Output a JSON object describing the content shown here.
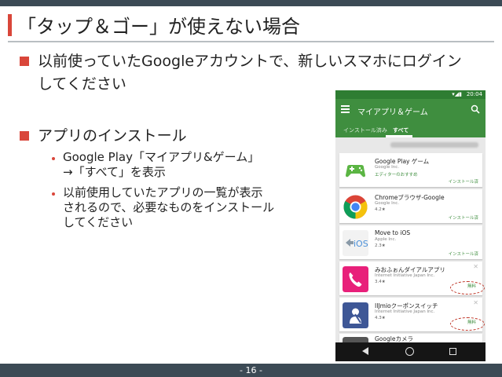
{
  "slide": {
    "title": "「タップ＆ゴー」が使えない場合",
    "page_number": "- 16 -"
  },
  "bullets": [
    {
      "text": "以前使っていたGoogleアカウントで、新しいスマホにログインしてください"
    },
    {
      "text": "アプリのインストール",
      "sub": [
        {
          "line1": "Google Play「マイアプリ&ゲーム」",
          "line2": "→「すべて」を表示"
        },
        {
          "line1": "以前使用していたアプリの一覧が表示",
          "line2": "されるので、必要なものをインストール",
          "line3": "してください"
        }
      ]
    }
  ],
  "phone": {
    "status_time": "20:04",
    "app_bar_title": "マイアプリ＆ゲーム",
    "tabs": [
      "インストール済み",
      "すべて"
    ],
    "apps": [
      {
        "name": "Google Play ゲーム",
        "developer": "Google Inc.",
        "extra": "エディターのおすすめ",
        "status": "インストール済",
        "icon": "google-play-games-icon"
      },
      {
        "name": "Chromeブラウザ-Google",
        "developer": "Google Inc.",
        "extra": "4.2★",
        "status": "インストール済",
        "icon": "chrome-icon"
      },
      {
        "name": "Move to iOS",
        "developer": "Apple Inc.",
        "extra": "2.3★",
        "status": "インストール済",
        "icon": "move-to-ios-icon"
      },
      {
        "name": "みおふぉんダイアルアプリ",
        "developer": "Internet Initiative Japan Inc.",
        "extra": "3.4★",
        "status": "無料",
        "icon": "phone-dial-icon"
      },
      {
        "name": "IIJmioクーポンスイッチ",
        "developer": "Internet Initiative Japan Inc.",
        "extra": "4.3★",
        "status": "無料",
        "icon": "coupon-switch-icon"
      },
      {
        "name": "Googleカメラ",
        "icon": "google-camera-icon"
      }
    ],
    "colors": {
      "status_bar": "#2e7d32",
      "app_bar": "#3f8e3f",
      "accent": "#d9463a"
    }
  }
}
